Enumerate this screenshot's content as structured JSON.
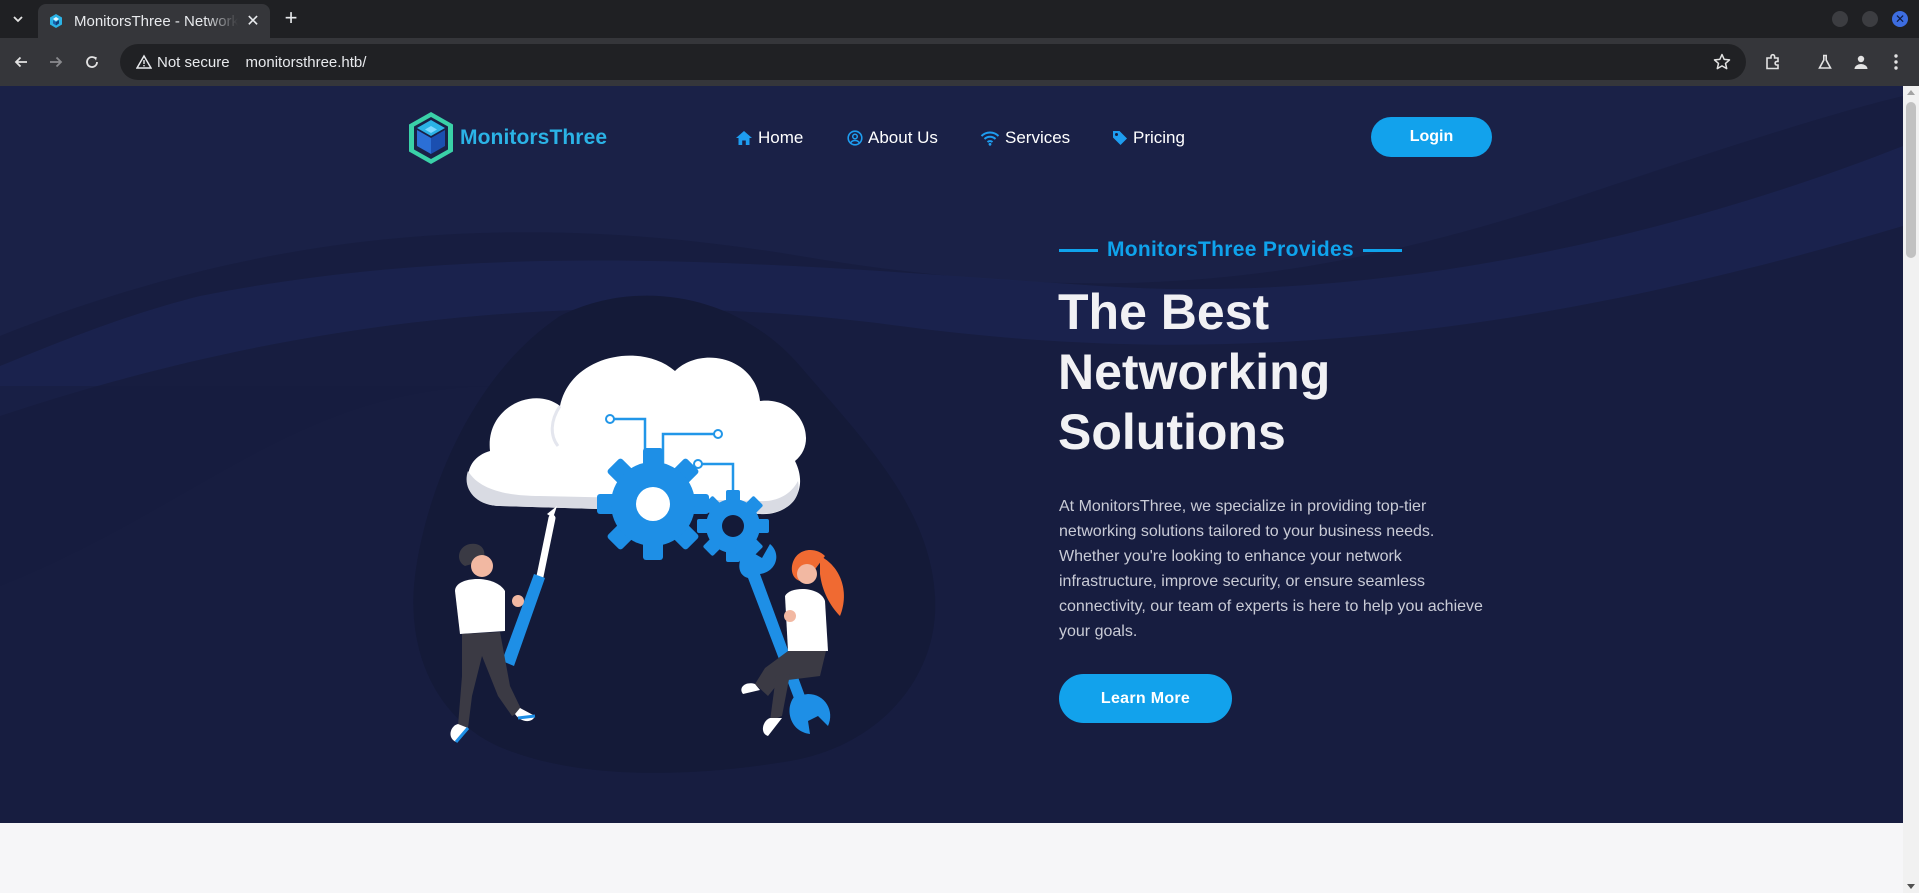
{
  "browser": {
    "tab_title": "MonitorsThree - Networking Solutions",
    "security_label": "Not secure",
    "url": "monitorsthree.htb/"
  },
  "site": {
    "logo_text": "MonitorsThree",
    "nav": [
      {
        "label": "Home",
        "icon": "home-icon"
      },
      {
        "label": "About Us",
        "icon": "user-circle-icon"
      },
      {
        "label": "Services",
        "icon": "wifi-icon"
      },
      {
        "label": "Pricing",
        "icon": "tag-icon"
      }
    ],
    "login_label": "Login"
  },
  "hero": {
    "eyebrow": "MonitorsThree Provides",
    "headline_lines": [
      "The Best",
      "Networking",
      "Solutions"
    ],
    "description": "At MonitorsThree, we specialize in providing top-tier networking solutions tailored to your business needs. Whether you're looking to enhance your network infrastructure, improve security, or ensure seamless connectivity, our team of experts is here to help you achieve your goals.",
    "cta_label": "Learn More"
  },
  "colors": {
    "hero_background": "#171d40",
    "accent": "#12a2ec",
    "logo_text": "#2bb3e6"
  }
}
